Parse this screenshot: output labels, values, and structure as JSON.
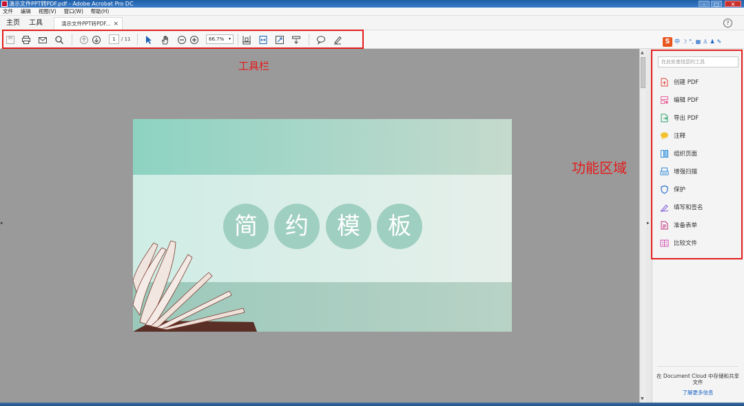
{
  "window": {
    "title": "演示文件PPT转PDF.pdf - Adobe Acrobat Pro DC",
    "min_label": "–",
    "max_label": "□",
    "close_label": "✕"
  },
  "menu": {
    "items": [
      "文件",
      "编辑",
      "视图(V)",
      "窗口(W)",
      "帮助(H)"
    ]
  },
  "tabs": {
    "home": "主页",
    "tools": "工具",
    "document": "演示文件PPT转PDF...",
    "close": "×",
    "help": "?"
  },
  "toolbar": {
    "page_current": "1",
    "page_total": "/ 11",
    "zoom": "66.7%",
    "zoom_caret": "▾"
  },
  "ime": {
    "logo": "S",
    "items": [
      "中",
      "☽",
      "°,",
      "▦",
      "♙",
      "♟",
      "✎"
    ]
  },
  "slide": {
    "characters": [
      "简",
      "约",
      "模",
      "板"
    ],
    "colors": {
      "background_left": "#8dd3c2",
      "background_right": "#c4dacd",
      "circle": "#9fcfc0"
    }
  },
  "annotations": {
    "toolbar": "工具栏",
    "panel": "功能区域",
    "color": "#e41b1b"
  },
  "right_pane": {
    "search_placeholder": "在此处查找您的工具",
    "tools": [
      {
        "label": "创建 PDF",
        "icon": "create-pdf-icon",
        "color": "#e0443c"
      },
      {
        "label": "编辑 PDF",
        "icon": "edit-pdf-icon",
        "color": "#e8609a"
      },
      {
        "label": "导出 PDF",
        "icon": "export-pdf-icon",
        "color": "#2aa36b"
      },
      {
        "label": "注释",
        "icon": "comment-icon",
        "color": "#f2c230"
      },
      {
        "label": "组织页面",
        "icon": "organize-pages-icon",
        "color": "#2e8bd8"
      },
      {
        "label": "增强扫描",
        "icon": "enhance-scan-icon",
        "color": "#2e8bd8"
      },
      {
        "label": "保护",
        "icon": "protect-icon",
        "color": "#2e6fd0"
      },
      {
        "label": "填写和签名",
        "icon": "fill-sign-icon",
        "color": "#7b5bd6"
      },
      {
        "label": "准备表单",
        "icon": "prepare-form-icon",
        "color": "#c0307a"
      },
      {
        "label": "比较文件",
        "icon": "compare-files-icon",
        "color": "#d04ab0"
      }
    ],
    "cloud_text": "在 Document Cloud 中存储和共享文件",
    "cloud_link": "了解更多信息"
  }
}
